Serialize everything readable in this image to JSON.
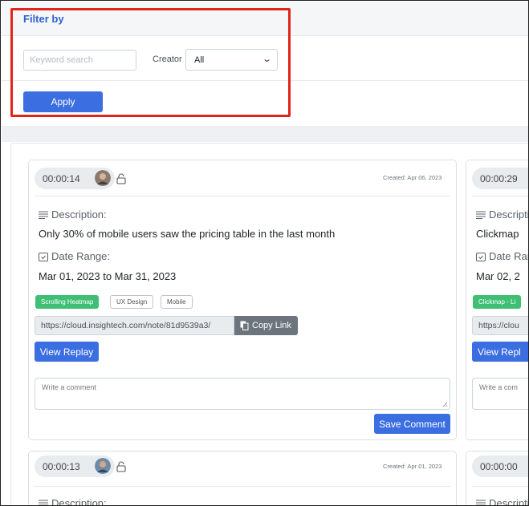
{
  "filter": {
    "title": "Filter by",
    "keyword_placeholder": "Keyword search",
    "creator_label": "Creator",
    "creator_value": "All",
    "apply_label": "Apply"
  },
  "cards": [
    {
      "duration": "00:00:14",
      "created": "Created: Apr 06, 2023",
      "description_label": "Description:",
      "description": "Only 30% of mobile users saw the pricing table in the last month",
      "date_range_label": "Date Range:",
      "date_range": "Mar 01, 2023 to Mar 31, 2023",
      "tags": [
        "Scrolling Heatmap",
        "UX Design",
        "Mobile"
      ],
      "link": "https://cloud.insightech.com/note/81d9539a3/",
      "copy_label": "Copy Link",
      "replay_label": "View Replay",
      "comment_placeholder": "Write a comment",
      "save_label": "Save Comment"
    },
    {
      "duration": "00:00:29",
      "description_label": "Description:",
      "description": "Clickmap",
      "date_range_label": "Date Range:",
      "date_range": "Mar 02, 2",
      "tags": [
        "Clickmap - Li"
      ],
      "link": "https://clou",
      "replay_label": "View Repl",
      "comment_placeholder": "Write a com"
    },
    {
      "duration": "00:00:13",
      "created": "Created: Apr 01, 2023",
      "description_label": "Description:"
    },
    {
      "duration": "00:00:00",
      "description_label": "Description:"
    }
  ],
  "colors": {
    "primary": "#3b6ee0",
    "success": "#3fbf74",
    "highlight": "#e0251b"
  }
}
